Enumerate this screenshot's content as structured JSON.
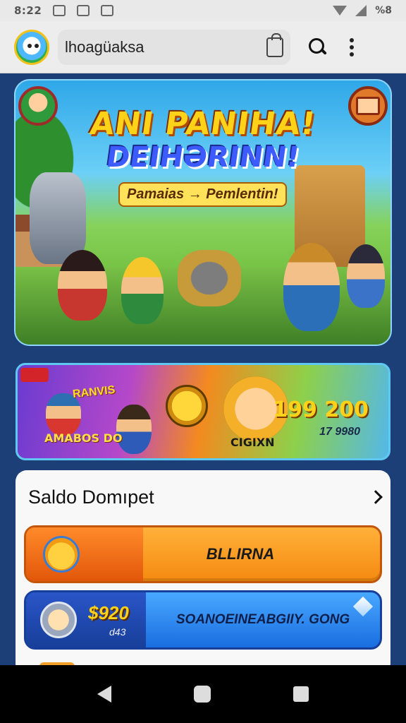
{
  "status_bar": {
    "time": "8:22",
    "battery": "%8"
  },
  "app_bar": {
    "search_text": "lhoagüaksa"
  },
  "hero": {
    "title": "ANI PANIHA!",
    "subtitle": "DEIHƏRINN!",
    "tagline": "Pamaias → Pemlentin!"
  },
  "promo": {
    "small_title": "RANVIS",
    "label": "AMABOS DO",
    "hero_name": "CIGIXN",
    "amount": "199 200",
    "sub": "17 9980"
  },
  "wallet": {
    "title": "Saldo Domıpet",
    "orange_button_label": "BLLIRNA",
    "blue_amount": "$920",
    "blue_sub": "d43",
    "blue_button_label": "SOANOEINEABGIIY. GONG"
  },
  "colors": {
    "orange": "#f58a10",
    "blue": "#1a6ee0",
    "background": "#1d3f78"
  }
}
